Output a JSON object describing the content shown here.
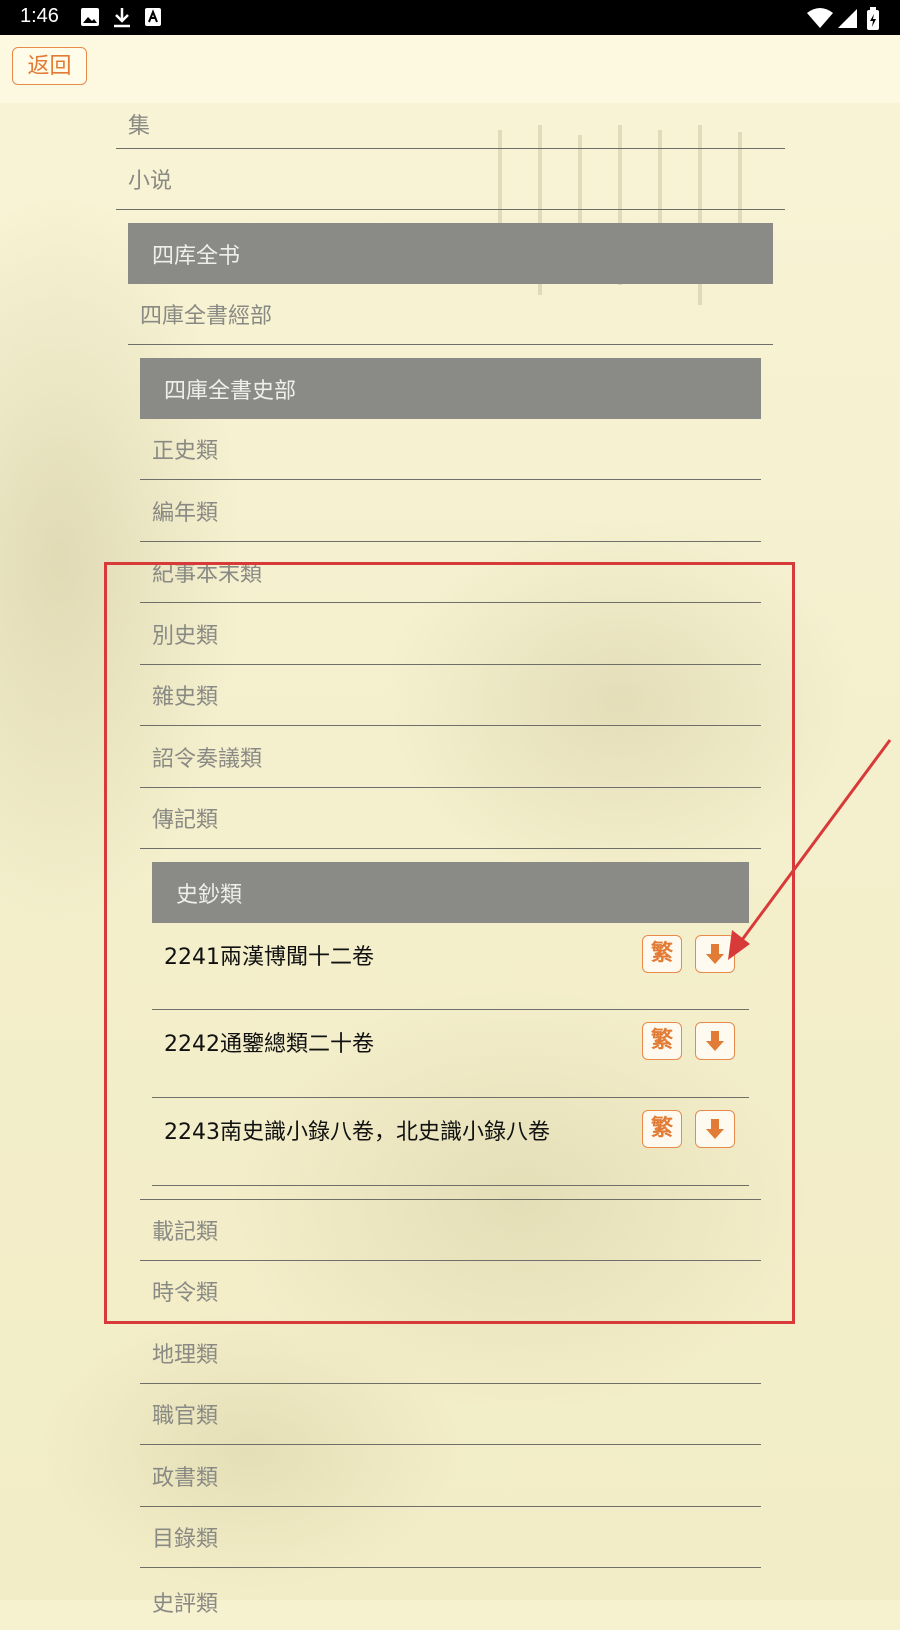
{
  "status_bar": {
    "time": "1:46"
  },
  "nav": {
    "back_label": "返回"
  },
  "items": {
    "ji": "集",
    "xiaoshuo": "小说",
    "siku": "四库全书",
    "jingbu": "四庫全書經部",
    "shibu": "四庫全書史部",
    "zhengshi": "正史類",
    "biannian": "編年類",
    "jishi": "紀事本末類",
    "bieshi": "別史類",
    "zashi": "雜史類",
    "zhaoling": "詔令奏議類",
    "zhuanji": "傳記類",
    "shichao": "史鈔類",
    "zaiji": "載記類",
    "shiling": "時令類",
    "dili": "地理類",
    "zhiguan": "職官類",
    "zhengshu": "政書類",
    "mulu": "目錄類",
    "shiping": "史評類"
  },
  "books": [
    {
      "title": "2241兩漢博聞十二卷",
      "trad_label": "繁"
    },
    {
      "title": "2242通鑒總類二十卷",
      "trad_label": "繁"
    },
    {
      "title": "2243南史識小錄八卷，北史識小錄八卷",
      "trad_label": "繁"
    }
  ],
  "icons": {
    "download": "download-arrow-icon"
  },
  "colors": {
    "accent": "#e27b36",
    "header_bg": "#8a8a87",
    "highlight": "#d83a3a"
  }
}
